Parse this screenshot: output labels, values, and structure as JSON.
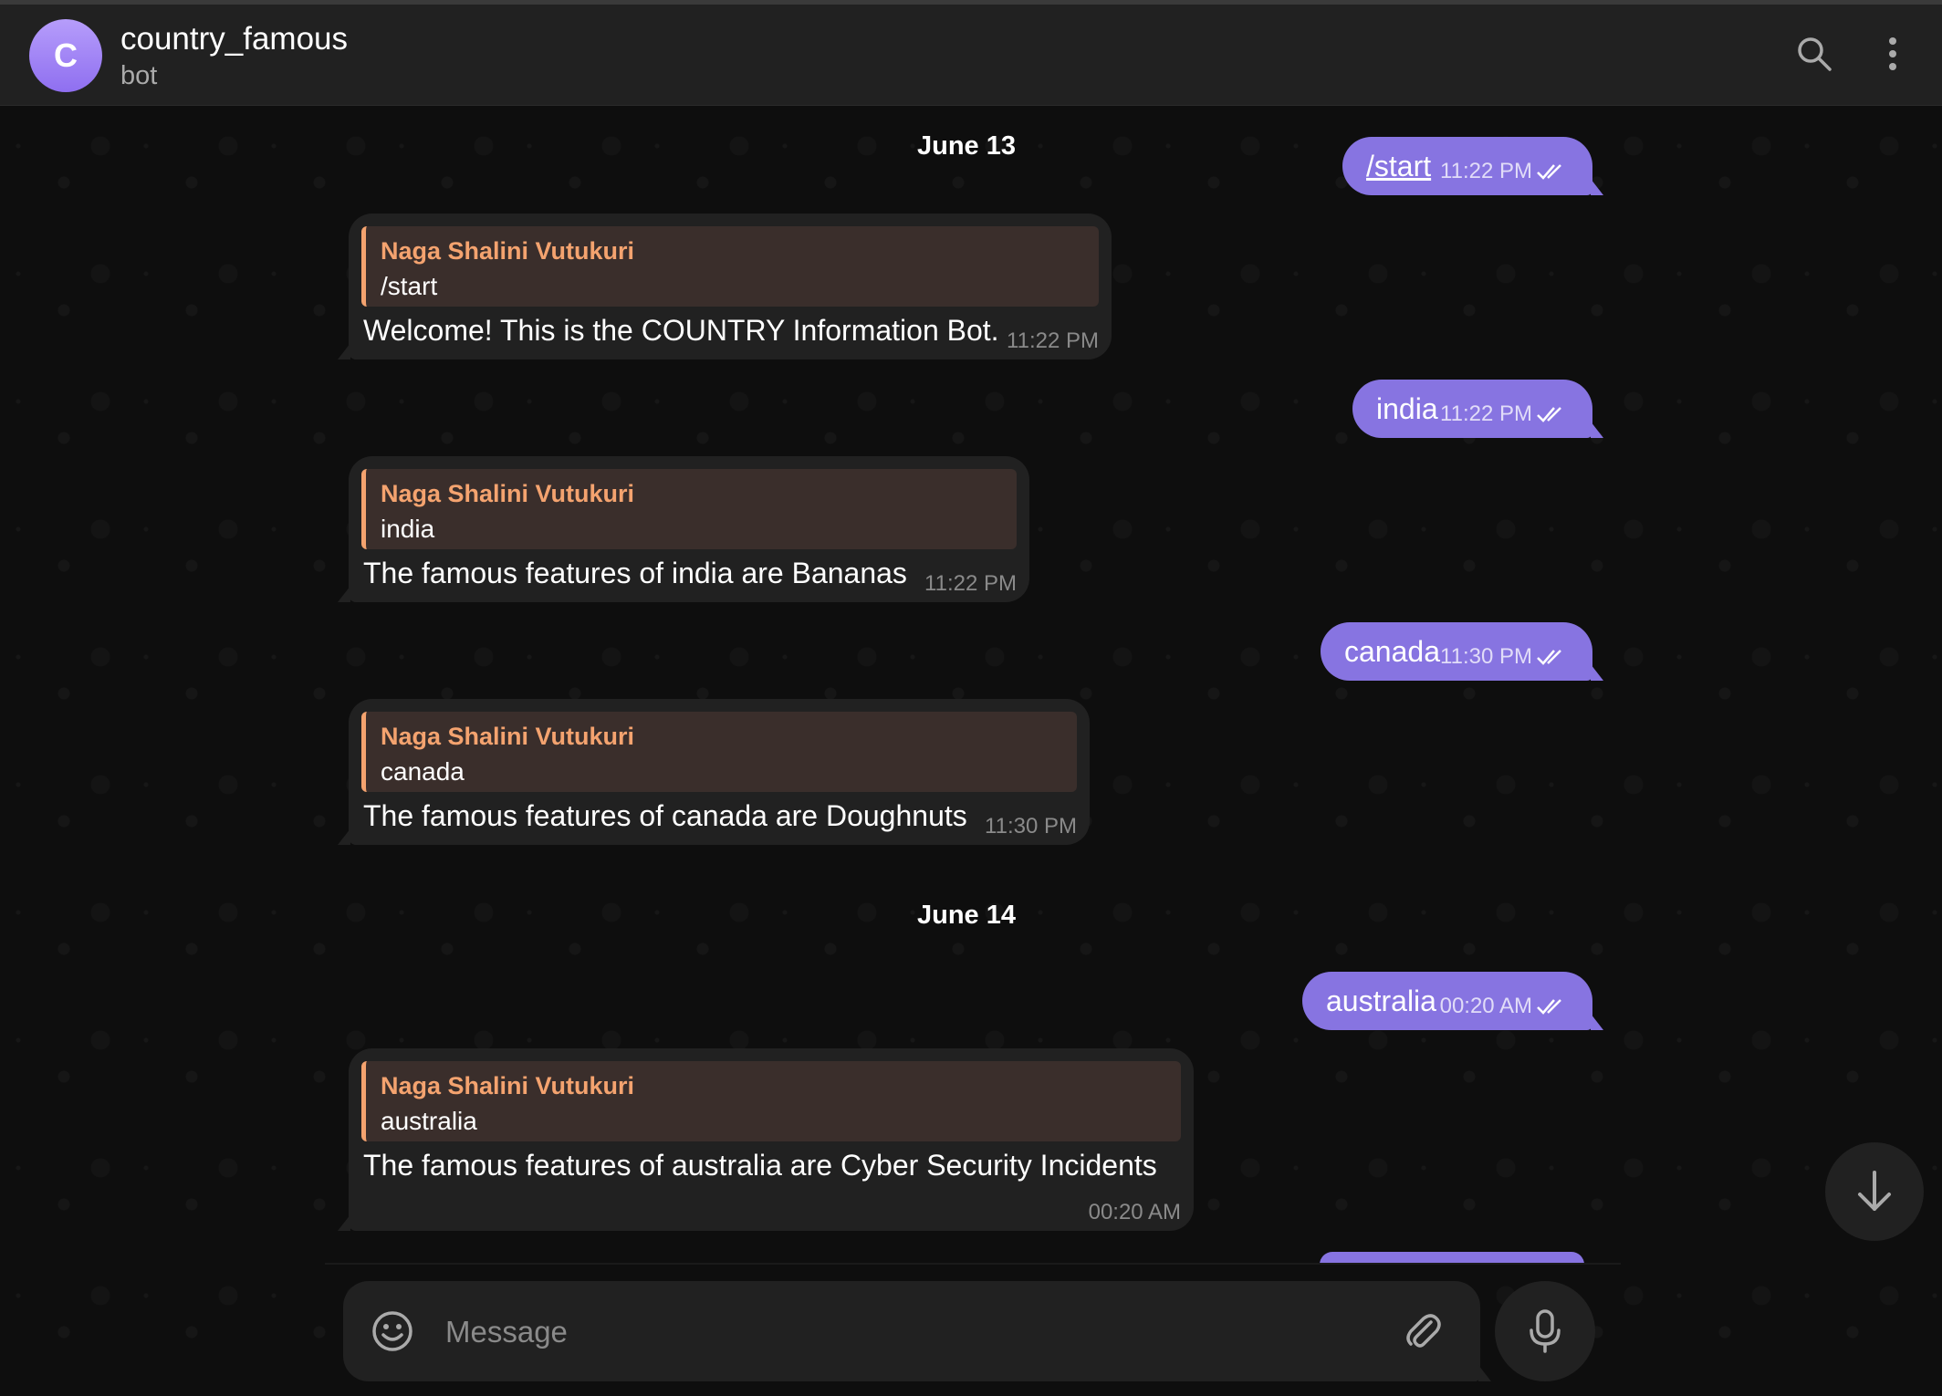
{
  "header": {
    "avatar_letter": "C",
    "title": "country_famous",
    "subtitle": "bot"
  },
  "dates": [
    "June 13",
    "June 14"
  ],
  "messages": [
    {
      "dir": "out",
      "text": "/start",
      "time": "11:22 PM"
    },
    {
      "dir": "in",
      "reply_name": "Naga Shalini Vutukuri",
      "reply_text": "/start",
      "text": "Welcome! This is the COUNTRY Information Bot.",
      "time": "11:22 PM"
    },
    {
      "dir": "out",
      "text": "india",
      "time": "11:22 PM"
    },
    {
      "dir": "in",
      "reply_name": "Naga Shalini Vutukuri",
      "reply_text": "india",
      "text": "The famous features of india are Bananas",
      "time": "11:22 PM"
    },
    {
      "dir": "out",
      "text": "canada",
      "time": "11:30 PM"
    },
    {
      "dir": "in",
      "reply_name": "Naga Shalini Vutukuri",
      "reply_text": "canada",
      "text": "The famous features of canada are Doughnuts",
      "time": "11:30 PM"
    },
    {
      "dir": "out",
      "text": "australia",
      "time": "00:20 AM"
    },
    {
      "dir": "in",
      "reply_name": "Naga Shalini Vutukuri",
      "reply_text": "australia",
      "text": "The famous features of australia are Cyber Security Incidents",
      "time": "00:20 AM"
    }
  ],
  "composer": {
    "placeholder": "Message"
  },
  "colors": {
    "accent": "#8774e1",
    "reply_name": "#f4a36f",
    "bubble_in": "#212121",
    "background": "#0f0f0f"
  },
  "icons": [
    "search-icon",
    "more-vertical-icon",
    "double-check-icon",
    "arrow-down-icon",
    "emoji-icon",
    "paperclip-icon",
    "microphone-icon"
  ]
}
